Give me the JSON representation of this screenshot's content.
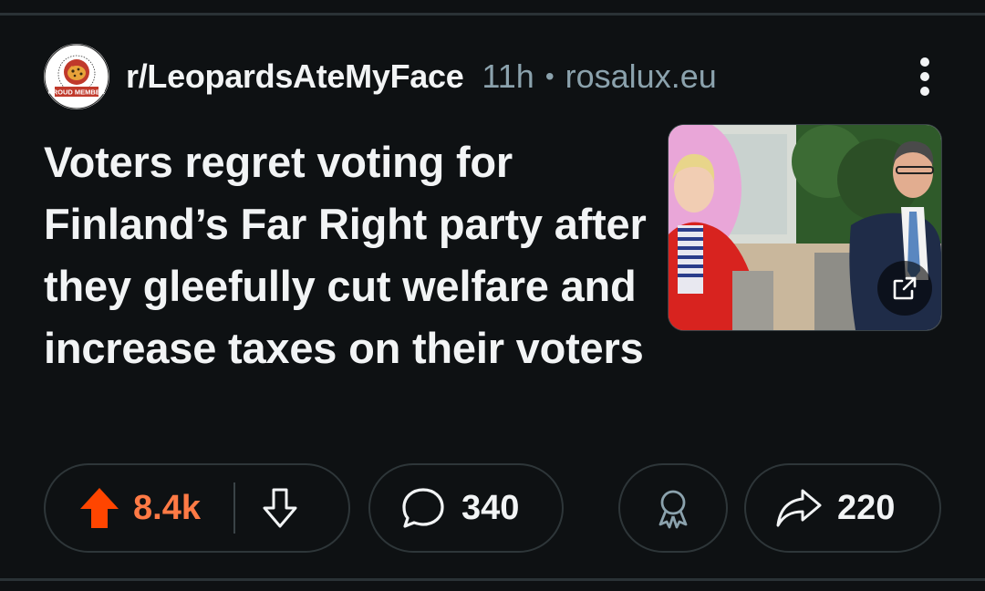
{
  "post": {
    "subreddit": "r/LeopardsAteMyFace",
    "age": "11h",
    "separator": "•",
    "domain": "rosalux.eu",
    "title": "Voters regret voting for Finland’s Far Right party after they gleefully cut welfare and increase taxes on their voters",
    "avatar": {
      "badge_text": "PROUD MEMBER",
      "icon": "leopard-icon"
    }
  },
  "actions": {
    "upvotes": "8.4k",
    "comments": "340",
    "shares": "220",
    "upvote_color": "#ff4500",
    "upvote_count_color": "#ff7a45"
  },
  "icons": {
    "menu": "more-vertical-icon",
    "upvote": "upvote-arrow-icon",
    "downvote": "downvote-arrow-icon",
    "comment": "comment-bubble-icon",
    "award": "award-ribbon-icon",
    "share": "share-arrow-icon",
    "external": "external-link-icon"
  },
  "colors": {
    "background": "#0e1113",
    "text": "#f2f4f5",
    "meta": "#8ba2ad",
    "pill_border": "#2e3639"
  }
}
